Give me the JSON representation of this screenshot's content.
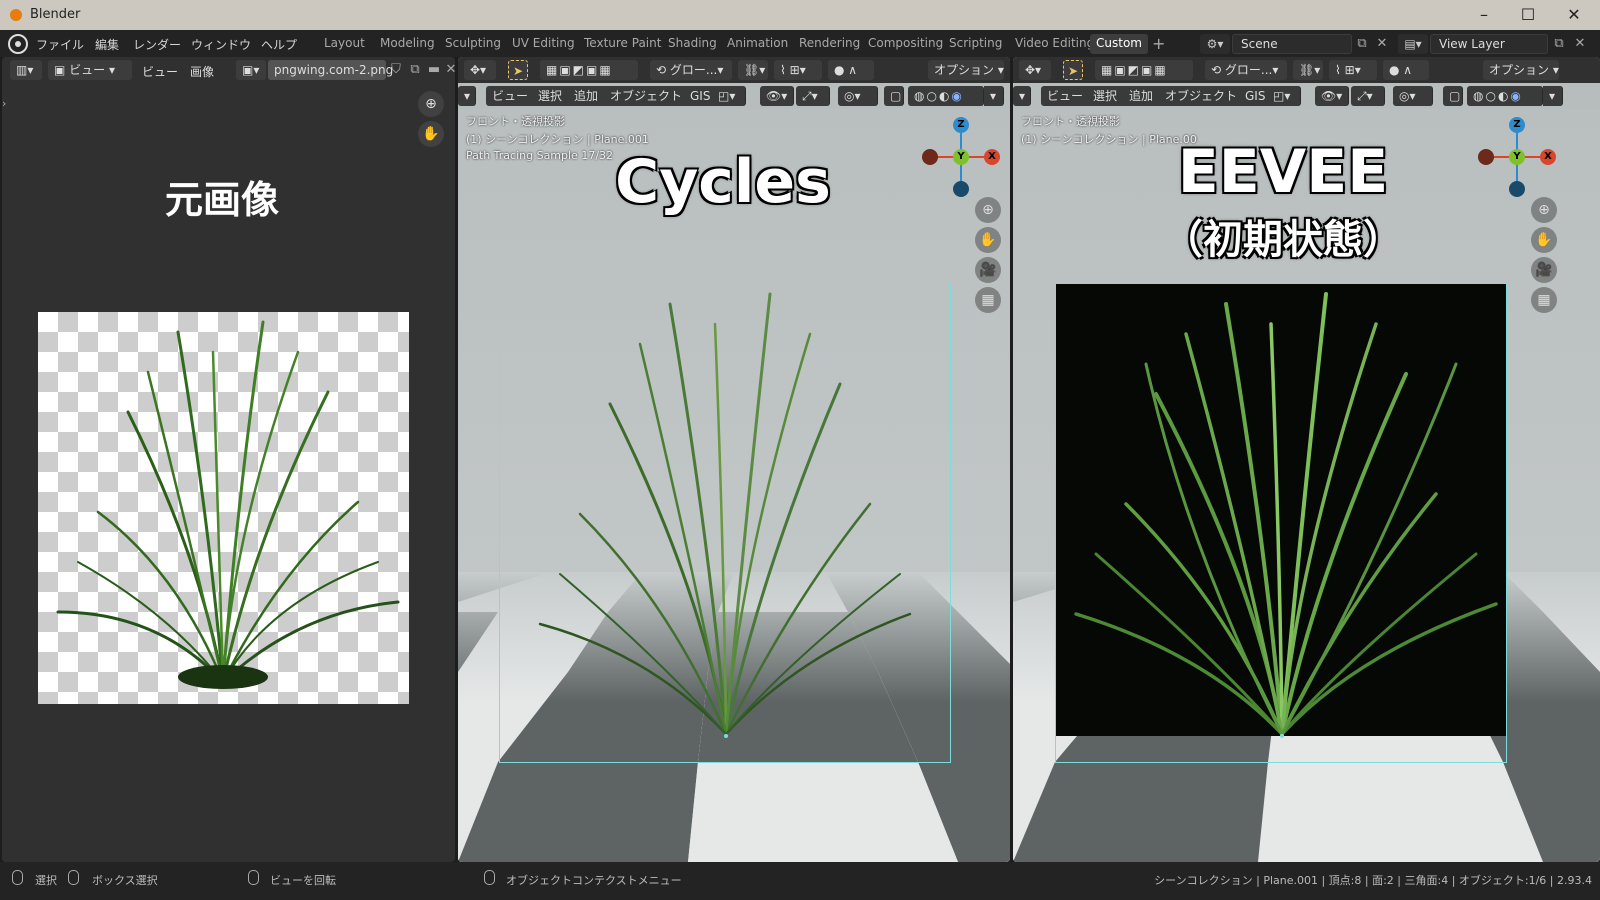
{
  "window": {
    "title": "Blender"
  },
  "menu": [
    "ファイル",
    "編集",
    "レンダー",
    "ウィンドウ",
    "ヘルプ"
  ],
  "workspace_tabs": [
    "Layout",
    "Modeling",
    "Sculpting",
    "UV Editing",
    "Texture Paint",
    "Shading",
    "Animation",
    "Rendering",
    "Compositing",
    "Scripting",
    "Video Editing",
    "Custom"
  ],
  "active_tab": "Custom",
  "scene": {
    "name": "Scene",
    "view_layer": "View Layer"
  },
  "image_editor": {
    "view_label": "ビュー",
    "menu_view": "ビュー",
    "menu_image": "画像",
    "filename": "pngwing.com-2.png",
    "label": "元画像"
  },
  "viewport_cycles": {
    "orientation": "グロー...",
    "options": "オプション",
    "menus": [
      "ビュー",
      "選択",
      "追加",
      "オブジェクト",
      "GIS"
    ],
    "info_line1": "フロント・透視投影",
    "info_line2": "(1) シーンコレクション | Plane.001",
    "info_line3": "Path Tracing Sample 17/32",
    "label": "Cycles"
  },
  "viewport_eevee": {
    "orientation": "グロー...",
    "options": "オプション",
    "menus": [
      "ビュー",
      "選択",
      "追加",
      "オブジェクト",
      "GIS"
    ],
    "info_line1": "フロント・透視投影",
    "info_line2": "(1) シーンコレクション | Plane.00",
    "label": "EEVEE",
    "sublabel": "（初期状態）"
  },
  "gizmo": {
    "z": "Z",
    "y": "Y",
    "x": "X"
  },
  "status_bar": {
    "select": "選択",
    "box_select": "ボックス選択",
    "rotate_view": "ビューを回転",
    "context_menu": "オブジェクトコンテクストメニュー",
    "stats": "シーンコレクション | Plane.001 | 頂点:8 | 面:2 | 三角面:4 | オブジェクト:1/6 | 2.93.4"
  },
  "colors": {
    "accent": "#4772b3",
    "blender_orange": "#e87d0d",
    "gizmo_x": "#d9462c",
    "gizmo_y": "#7fc12a",
    "gizmo_z": "#2c8ccf"
  }
}
